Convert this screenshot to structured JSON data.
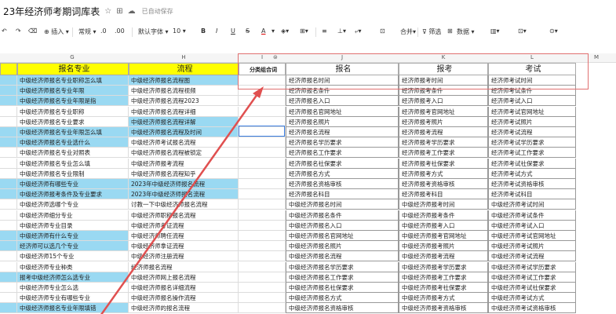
{
  "titlebar": {
    "doc_title": "23年经济师考期词库表",
    "saved_text": "已自动保存"
  },
  "toolbar": {
    "insert_label": "插入",
    "style_label": "常规",
    "font_label": "默认字体",
    "font_size": "10",
    "bold": "B",
    "italic": "I",
    "underline": "U",
    "strike": "S",
    "font_color": "A",
    "merge_label": "合并",
    "filter_label": "筛选",
    "number_label": "数据"
  },
  "columns": [
    "G",
    "H",
    "I",
    "J",
    "K",
    "L",
    "M"
  ],
  "header_row": {
    "G": "报名专业",
    "H": "流程",
    "I": "分类组合词",
    "J": "报名",
    "K": "报考",
    "L": "考试"
  },
  "rows": [
    {
      "g": "中级经济师报名专业职称怎么填",
      "h": "中级经济师报名流程图",
      "j": "经济师报名时间",
      "k": "经济师报考时间",
      "l": "经济师考试时间",
      "gb": true,
      "hb": true
    },
    {
      "g": "中级经济师报名专业年限",
      "h": "中级经济师报名流程视频",
      "j": "经济师报名条件",
      "k": "经济师报考条件",
      "l": "经济师考试条件",
      "gb": true,
      "hb": false
    },
    {
      "g": "中级经济师报名专业年限是指",
      "h": "中级经济师报名流程2023",
      "j": "经济师报名入口",
      "k": "经济师报考入口",
      "l": "经济师考试入口",
      "gb": true,
      "hb": false
    },
    {
      "g": "中级经济师报名专业职称",
      "h": "中级经济师报名流程详细",
      "j": "经济师报名官网地址",
      "k": "经济师报考官网地址",
      "l": "经济师考试官网地址",
      "gb": false,
      "hb": false
    },
    {
      "g": "中级经济师报名专业要求",
      "h": "中级经济师报名流程详解",
      "j": "经济师报名照片",
      "k": "经济师报考照片",
      "l": "经济师考试照片",
      "gb": false,
      "hb": true
    },
    {
      "g": "中级经济师报名专业年限怎么填",
      "h": "中级经济师报名流程及时间",
      "j": "经济师报名流程",
      "k": "经济师报考流程",
      "l": "经济师考试流程",
      "gb": true,
      "hb": true
    },
    {
      "g": "中级经济师报名专业选什么",
      "h": "中级经济师考试报名流程",
      "j": "经济师报名学历要求",
      "k": "经济师报考学历要求",
      "l": "经济师考试学历要求",
      "gb": true,
      "hb": false
    },
    {
      "g": "中级经济师报名专业对照表",
      "h": "中级经济师报名流程被锁定",
      "j": "经济师报名工作要求",
      "k": "经济师报考工作要求",
      "l": "经济师考试工作要求",
      "gb": false,
      "hb": false
    },
    {
      "g": "中级经济师报名专业怎么填",
      "h": "中级经济师报考流程",
      "j": "经济师报名社保要求",
      "k": "经济师报考社保要求",
      "l": "经济师考试社保要求",
      "gb": false,
      "hb": false
    },
    {
      "g": "中级经济师报名专业限制",
      "h": "中级经济师报名流程知乎",
      "j": "经济师报名方式",
      "k": "经济师报考方式",
      "l": "经济师考试方式",
      "gb": false,
      "hb": false
    },
    {
      "g": "中级经济师有哪些专业",
      "h": "2023年中级经济师报名流程",
      "j": "经济师报名资格审核",
      "k": "经济师报考资格审核",
      "l": "经济师考试资格审核",
      "gb": true,
      "hb": true
    },
    {
      "g": "中级经济师报考条件及专业要求",
      "h": "2023年中级经济师报名流程",
      "j": "经济师报名科目",
      "k": "经济师报考科目",
      "l": "经济师考试科目",
      "gb": true,
      "hb": true
    },
    {
      "g": "中级经济师选哪个专业",
      "h": "讨教一下中级经济师报名流程",
      "j": "中级经济师报名时间",
      "k": "中级经济师报考时间",
      "l": "中级经济师考试时间",
      "gb": false,
      "hb": false
    },
    {
      "g": "中级经济师细分专业",
      "h": "中级经济师职称报名流程",
      "j": "中级经济师报名条件",
      "k": "中级经济师报考条件",
      "l": "中级经济师考试条件",
      "gb": false,
      "hb": false
    },
    {
      "g": "中级经济师专业目录",
      "h": "中级经济师考证流程",
      "j": "中级经济师报名入口",
      "k": "中级经济师报考入口",
      "l": "中级经济师考试入口",
      "gb": false,
      "hb": false
    },
    {
      "g": "中级经济师有什么专业",
      "h": "中级经济师聘任流程",
      "j": "中级经济师报名官网地址",
      "k": "中级经济师报考官网地址",
      "l": "中级经济师考试官网地址",
      "gb": true,
      "hb": false
    },
    {
      "g": "经济师可以选几个专业",
      "h": "中级经济师拿证流程",
      "j": "中级经济师报名照片",
      "k": "中级经济师报考照片",
      "l": "中级经济师考试照片",
      "gb": true,
      "hb": false
    },
    {
      "g": "中级经济师15个专业",
      "h": "中级经济师注册流程",
      "j": "中级经济师报名流程",
      "k": "中级经济师报考流程",
      "l": "中级经济师考试流程",
      "gb": false,
      "hb": false
    },
    {
      "g": "中级经济师专业种类",
      "h": "经济师报名流程",
      "j": "中级经济师报名学历要求",
      "k": "中级经济师报考学历要求",
      "l": "中级经济师考试学历要求",
      "gb": false,
      "hb": false
    },
    {
      "g": "报考中级经济师怎么选专业",
      "h": "中级经济师网上报名流程",
      "j": "中级经济师报名工作要求",
      "k": "中级经济师报考工作要求",
      "l": "中级经济师考试工作要求",
      "gb": true,
      "hb": false
    },
    {
      "g": "中级经济师专业怎么选",
      "h": "中级经济师报名详细流程",
      "j": "中级经济师报名社保要求",
      "k": "中级经济师报考社保要求",
      "l": "中级经济师考试社保要求",
      "gb": false,
      "hb": false
    },
    {
      "g": "中级经济师专业有哪些专业",
      "h": "中级经济师报名操作流程",
      "j": "中级经济师报名方式",
      "k": "中级经济师报考方式",
      "l": "中级经济师考试方式",
      "gb": false,
      "hb": false
    },
    {
      "g": "中级经济师报名专业年限填错",
      "h": "中级经济师的报名流程",
      "j": "中级经济师报名资格审核",
      "k": "中级经济师报考资格审核",
      "l": "中级经济师考试资格审核",
      "gb": true,
      "hb": false
    }
  ],
  "colors": {
    "yellow": "#ffff00",
    "blue_highlight": "#9ad9f2",
    "red_annotation": "#e05050"
  }
}
